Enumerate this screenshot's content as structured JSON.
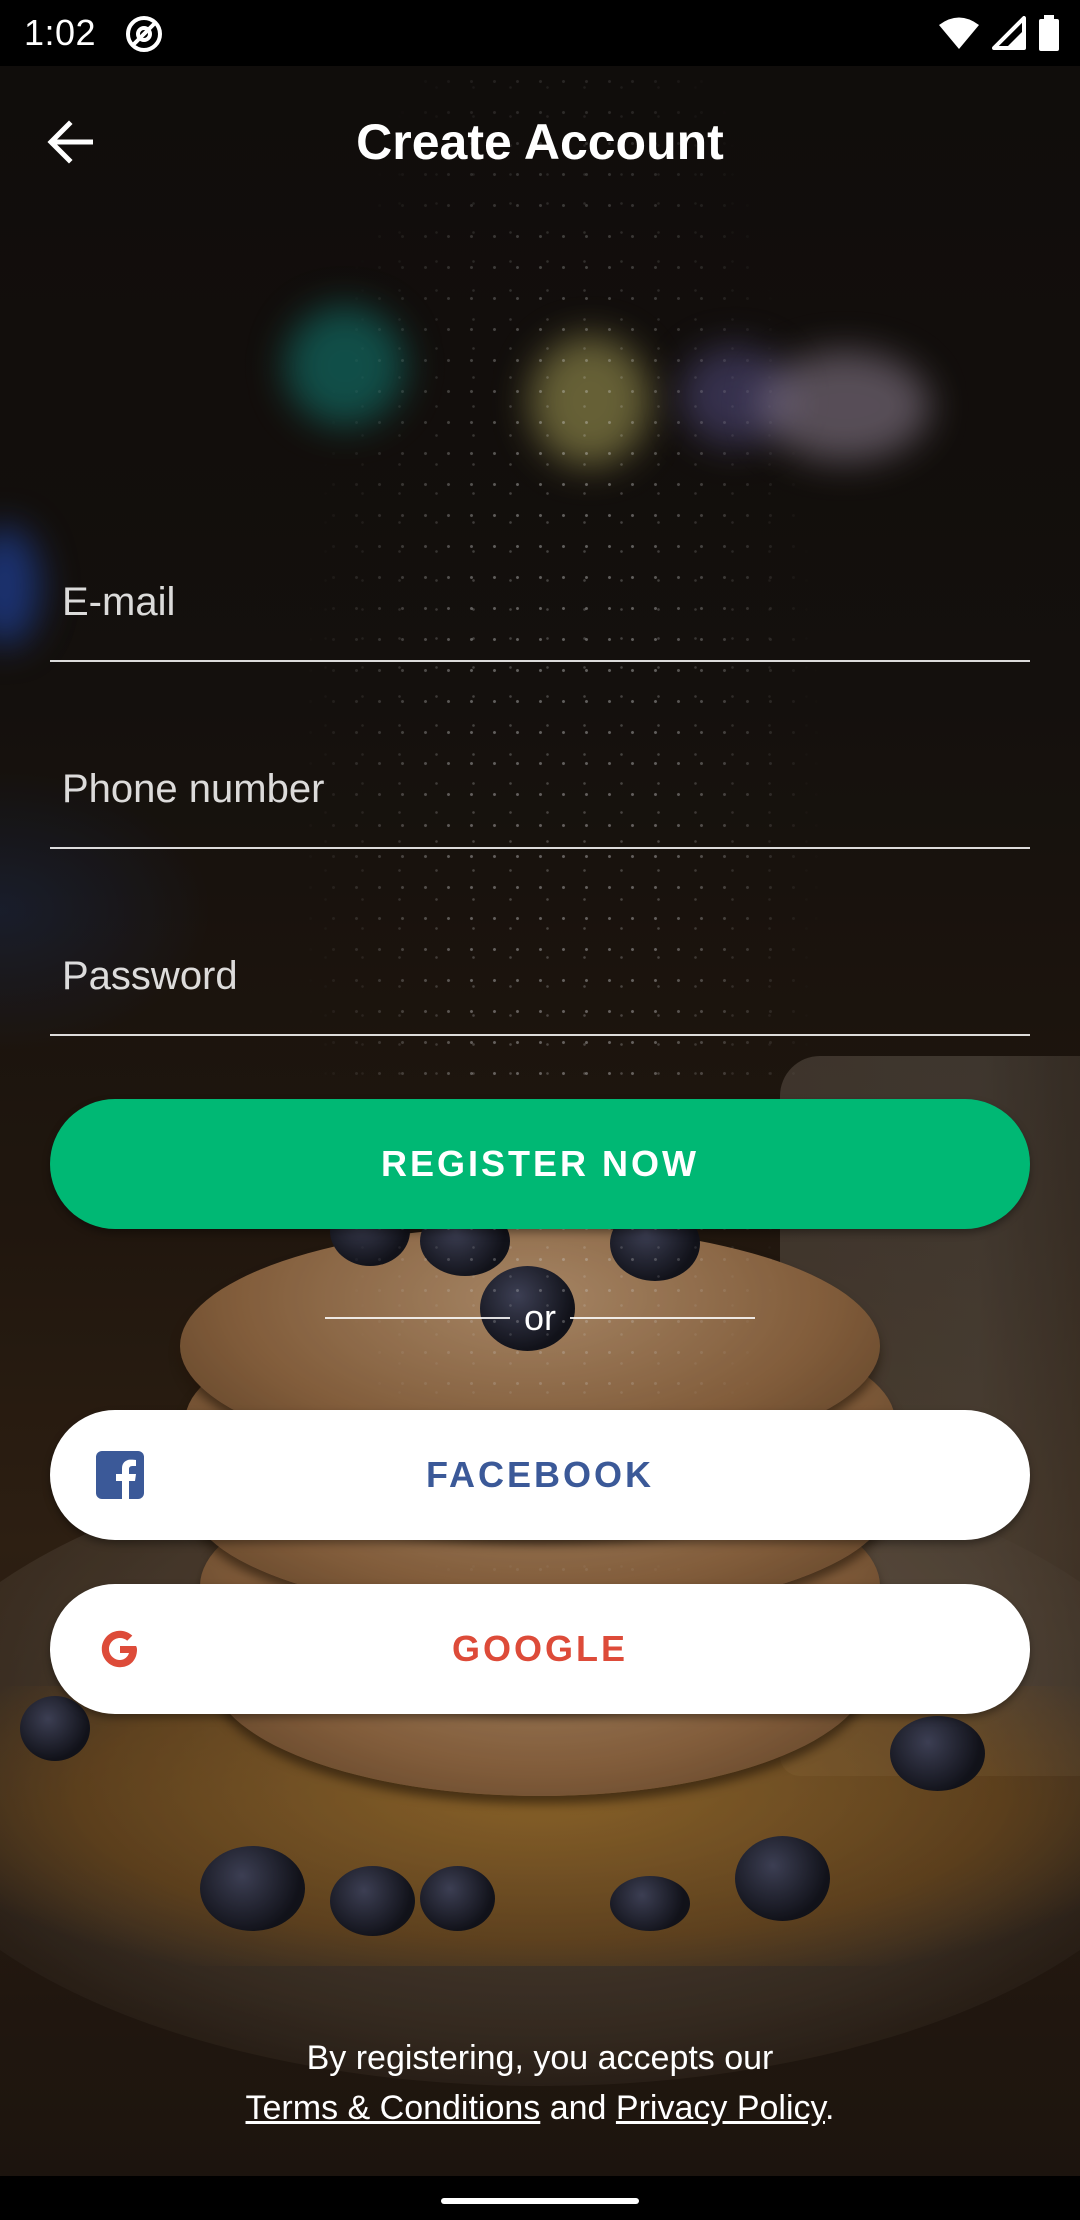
{
  "status_bar": {
    "time": "1:02",
    "icons": [
      "at-sign-icon",
      "wifi-icon",
      "signal-icon",
      "battery-icon"
    ]
  },
  "header": {
    "title": "Create Account",
    "back_icon": "arrow-left-icon"
  },
  "form": {
    "email": {
      "placeholder": "E-mail",
      "value": ""
    },
    "phone": {
      "placeholder": "Phone number",
      "value": ""
    },
    "password": {
      "placeholder": "Password",
      "value": ""
    }
  },
  "buttons": {
    "register": "REGISTER NOW",
    "divider": "or",
    "facebook": "FACEBOOK",
    "google": "GOOGLE"
  },
  "footer": {
    "line1": "By registering, you accepts our",
    "terms": "Terms & Conditions",
    "and": " and ",
    "privacy": "Privacy Policy",
    "period": "."
  },
  "colors": {
    "register_bg": "#00b874",
    "facebook": "#3b5998",
    "google": "#dd4b39",
    "text": "#ffffff"
  }
}
